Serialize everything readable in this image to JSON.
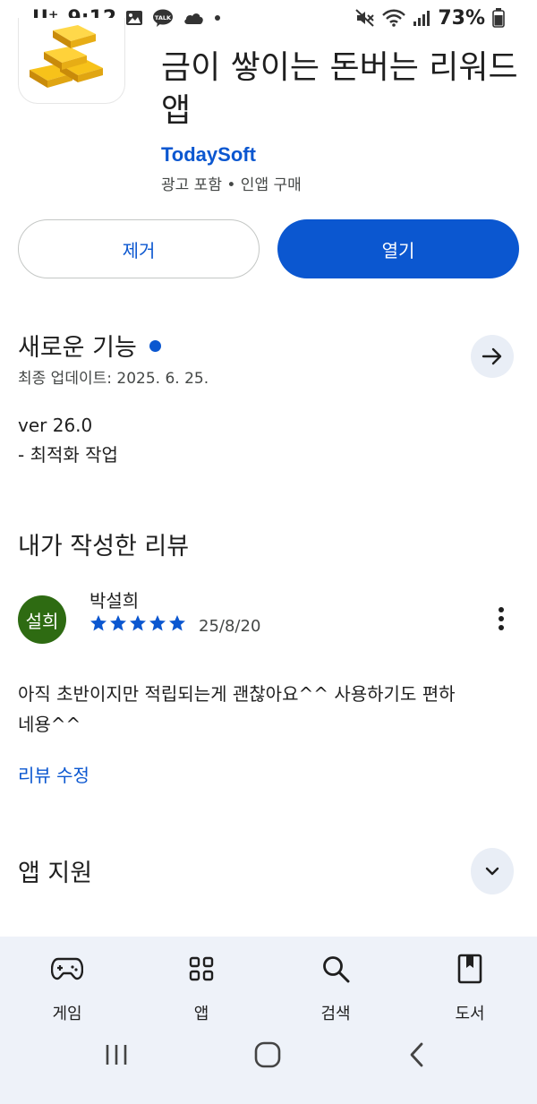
{
  "status_bar": {
    "carrier": "U⁺",
    "time": "9:12",
    "battery": "73%",
    "icons": [
      "gallery-icon",
      "kakaotalk-icon",
      "cloud-icon",
      "dot-icon",
      "mute-icon",
      "wifi-icon",
      "signal-icon",
      "battery-icon"
    ],
    "talk_badge": "TALK"
  },
  "app": {
    "title": "금이 쌓이는 돈버는 리워드 앱",
    "developer": "TodaySoft",
    "meta": "광고 포함 • 인앱 구매",
    "icon": "gold-bars-icon"
  },
  "actions": {
    "uninstall_label": "제거",
    "open_label": "열기"
  },
  "whats_new": {
    "title": "새로운 기능",
    "updated": "최종 업데이트: 2025. 6. 25.",
    "version": "ver 26.0",
    "notes": "- 최적화 작업",
    "accent": "#0b57d0"
  },
  "my_review": {
    "title": "내가 작성한 리뷰",
    "avatar_text": "설희",
    "avatar_color": "#2e6b12",
    "reviewer": "박설희",
    "rating": 5,
    "rating_max": 5,
    "date": "25/8/20",
    "text": "아직 초반이지만 적립되는게 괜찮아요^^ 사용하기도 편하네용^^",
    "edit_label": "리뷰 수정"
  },
  "app_support": {
    "title": "앱 지원"
  },
  "bottom_nav": {
    "items": [
      {
        "label": "게임",
        "icon": "gamepad-icon"
      },
      {
        "label": "앱",
        "icon": "apps-grid-icon"
      },
      {
        "label": "검색",
        "icon": "search-icon"
      },
      {
        "label": "도서",
        "icon": "book-icon"
      }
    ]
  },
  "system_nav": [
    "recent-apps-icon",
    "home-icon",
    "back-icon"
  ]
}
